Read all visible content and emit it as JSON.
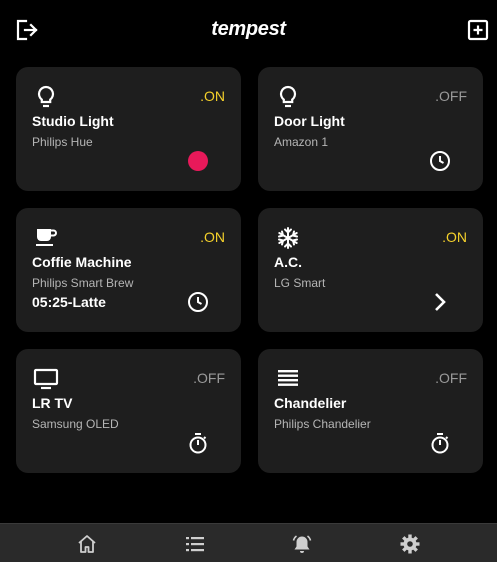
{
  "app": {
    "title": "tempest"
  },
  "header": {
    "logout_icon": "logout-icon",
    "add_icon": "add-box-icon"
  },
  "colors": {
    "on": "#f5d12b",
    "off": "#9a9a9a",
    "indicator": "#e8195a",
    "card_bg": "#1e1e1e"
  },
  "devices": [
    {
      "name": "Studio Light",
      "brand": "Philips Hue",
      "state": ".ON",
      "info": "",
      "icon": "lightbulb-icon",
      "action": "status-dot"
    },
    {
      "name": "Door Light",
      "brand": "Amazon 1",
      "state": ".OFF",
      "info": "",
      "icon": "lightbulb-icon",
      "action": "clock-icon"
    },
    {
      "name": "Coffie Machine",
      "brand": "Philips Smart Brew",
      "state": ".ON",
      "info": "05:25-Latte",
      "icon": "coffee-cup-icon",
      "action": "clock-icon"
    },
    {
      "name": "A.C.",
      "brand": "LG Smart",
      "state": ".ON",
      "info": "",
      "icon": "snowflake-icon",
      "action": "chevron-right-icon"
    },
    {
      "name": "LR TV",
      "brand": "Samsung OLED",
      "state": ".OFF",
      "info": "",
      "icon": "tv-icon",
      "action": "timer-icon"
    },
    {
      "name": "Chandelier",
      "brand": "Philips Chandelier",
      "state": ".OFF",
      "info": "",
      "icon": "chandelier-icon",
      "action": "timer-icon"
    }
  ],
  "nav": [
    {
      "icon": "home-icon"
    },
    {
      "icon": "list-icon"
    },
    {
      "icon": "alarm-bell-icon"
    },
    {
      "icon": "settings-gear-icon"
    }
  ]
}
